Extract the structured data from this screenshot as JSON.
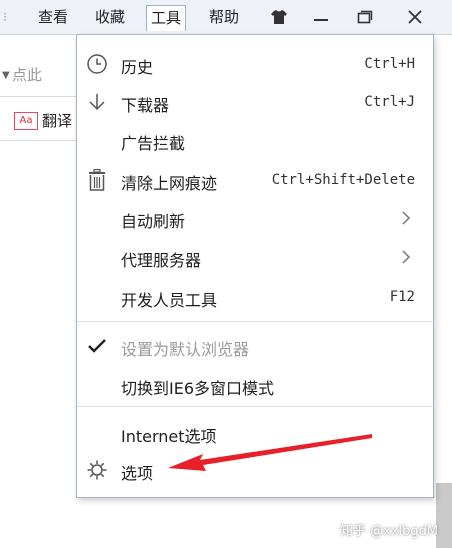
{
  "menubar": {
    "items": [
      {
        "label": "查看"
      },
      {
        "label": "收藏"
      },
      {
        "label": "工具"
      },
      {
        "label": "帮助"
      }
    ],
    "active_index": 2
  },
  "left_content": {
    "address_placeholder": "点此",
    "favorite_icon_text": "Aa",
    "favorite_label": "翻译"
  },
  "menu": {
    "items": [
      {
        "label": "历史",
        "shortcut": "Ctrl+H",
        "icon": "clock-icon"
      },
      {
        "label": "下载器",
        "shortcut": "Ctrl+J",
        "icon": "download-arrow-icon"
      },
      {
        "label": "广告拦截",
        "shortcut": "",
        "icon": ""
      },
      {
        "label": "清除上网痕迹",
        "shortcut": "Ctrl+Shift+Delete",
        "icon": "trash-icon"
      },
      {
        "label": "自动刷新",
        "shortcut": "",
        "icon": "",
        "submenu": true
      },
      {
        "label": "代理服务器",
        "shortcut": "",
        "icon": "",
        "submenu": true
      },
      {
        "label": "开发人员工具",
        "shortcut": "F12",
        "icon": ""
      },
      {
        "label": "设置为默认浏览器",
        "shortcut": "",
        "icon": "checkmark-icon",
        "disabled": true
      },
      {
        "label": "切换到IE6多窗口模式",
        "shortcut": "",
        "icon": ""
      },
      {
        "label": "Internet选项",
        "shortcut": "",
        "icon": ""
      },
      {
        "label": "选项",
        "shortcut": "",
        "icon": "gear-icon"
      }
    ]
  },
  "watermark": "知乎 @xxlbgdM",
  "colors": {
    "arrow": "#e8202a",
    "menu_border": "#a7b3c4",
    "menubar_bg": "#eef1f6"
  }
}
